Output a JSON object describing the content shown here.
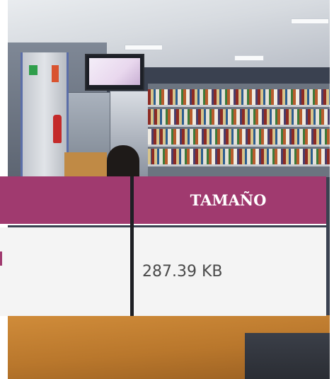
{
  "table": {
    "header": {
      "column_left_label": "",
      "column_right_label": "TAMAÑO"
    },
    "rows": [
      {
        "left_value": "",
        "size": "287.39 KB"
      }
    ]
  },
  "colors": {
    "header_background": "#a03a6f",
    "cell_background": "#f4f4f4",
    "divider": "#1e1f24",
    "header_text": "#ffffff",
    "cell_text": "#4a4a4a"
  }
}
